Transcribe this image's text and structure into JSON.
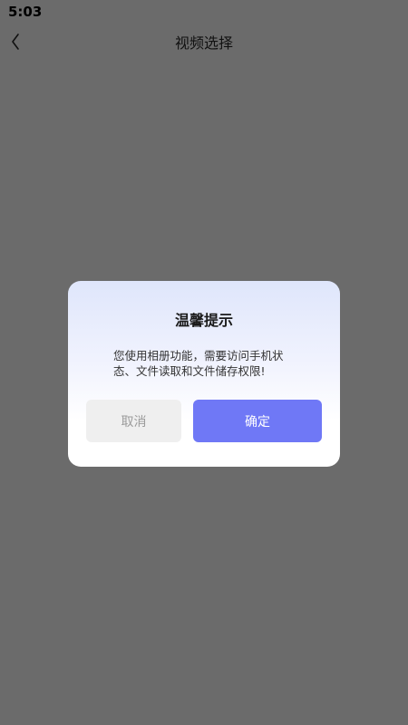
{
  "status_bar": {
    "time": "5:03"
  },
  "app_bar": {
    "back_icon": "chevron-left-icon",
    "title": "视频选择"
  },
  "dialog": {
    "title": "温馨提示",
    "message": "您使用相册功能，需要访问手机状态、文件读取和文件储存权限!",
    "cancel_label": "取消",
    "confirm_label": "确定"
  },
  "colors": {
    "overlay": "#6b6b6b",
    "primary": "#6f78f6",
    "cancel_bg": "#efefef",
    "cancel_text": "#9b9b9b",
    "dialog_gradient_top": "#dfe6fb"
  }
}
